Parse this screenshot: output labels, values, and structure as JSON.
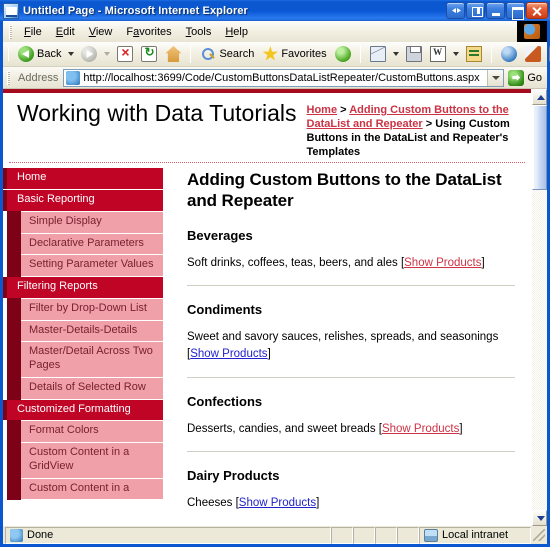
{
  "window": {
    "title": "Untitled Page - Microsoft Internet Explorer",
    "icon": "ie-page-icon",
    "buttons": {
      "restore_tabs": "",
      "panel": "",
      "minimize": "",
      "maximize": "",
      "close": ""
    }
  },
  "menu": {
    "items": [
      {
        "label": "File",
        "accel": "F"
      },
      {
        "label": "Edit",
        "accel": "E"
      },
      {
        "label": "View",
        "accel": "V"
      },
      {
        "label": "Favorites",
        "accel": "a"
      },
      {
        "label": "Tools",
        "accel": "T"
      },
      {
        "label": "Help",
        "accel": "H"
      }
    ],
    "logo_icon": "ie-logo-icon"
  },
  "toolbar": {
    "back_label": "Back",
    "forward_label": "",
    "search_label": "Search",
    "favorites_label": "Favorites",
    "icons": [
      "back-icon",
      "forward-icon",
      "stop-icon",
      "refresh-icon",
      "home-icon",
      "search-icon",
      "favorites-icon",
      "media-icon",
      "mail-icon",
      "print-icon",
      "edit-word-icon",
      "edit-page-icon",
      "msn-icon",
      "messenger-icon",
      "research-icon",
      "grid-icon"
    ]
  },
  "address": {
    "label": "Address",
    "value": "http://localhost:3699/Code/CustomButtonsDataListRepeater/CustomButtons.aspx",
    "go_label": "Go",
    "favicon": "ie-favicon"
  },
  "page": {
    "site_title": "Working with Data Tutorials",
    "breadcrumb": {
      "home": "Home",
      "sep1": " > ",
      "parent": "Adding Custom Buttons to the DataList and Repeater",
      "sep2": " > ",
      "current": "Using Custom Buttons in the DataList and Repeater's Templates"
    },
    "heading": "Adding Custom Buttons to the DataList and Repeater",
    "sidebar": [
      {
        "label": "Home",
        "level": "top"
      },
      {
        "label": "Basic Reporting",
        "level": "top"
      },
      {
        "label": "Simple Display",
        "level": "sub"
      },
      {
        "label": "Declarative Parameters",
        "level": "sub"
      },
      {
        "label": "Setting Parameter Values",
        "level": "sub"
      },
      {
        "label": "Filtering Reports",
        "level": "top"
      },
      {
        "label": "Filter by Drop-Down List",
        "level": "sub"
      },
      {
        "label": "Master-Details-Details",
        "level": "sub"
      },
      {
        "label": "Master/Detail Across Two Pages",
        "level": "sub"
      },
      {
        "label": "Details of Selected Row",
        "level": "sub"
      },
      {
        "label": "Customized Formatting",
        "level": "top"
      },
      {
        "label": "Format Colors",
        "level": "sub"
      },
      {
        "label": "Custom Content in a GridView",
        "level": "sub"
      },
      {
        "label": "Custom Content in a",
        "level": "sub"
      }
    ],
    "categories": [
      {
        "name": "Beverages",
        "description": "Soft drinks, coffees, teas, beers, and ales",
        "link_label": "Show Products",
        "link_state": "red"
      },
      {
        "name": "Condiments",
        "description": "Sweet and savory sauces, relishes, spreads, and seasonings",
        "link_label": "Show Products",
        "link_state": "blue"
      },
      {
        "name": "Confections",
        "description": "Desserts, candies, and sweet breads",
        "link_label": "Show Products",
        "link_state": "red"
      },
      {
        "name": "Dairy Products",
        "description": "Cheeses",
        "link_label": "Show Products",
        "link_state": "blue"
      }
    ],
    "colors": {
      "accent_red": "#c00426",
      "dark_red": "#7d0217",
      "sub_pink": "#f0a0a8",
      "link_red": "#cc3344",
      "link_blue": "#2222cc"
    }
  },
  "status": {
    "text": "Done",
    "zone": "Local intranet",
    "zone_icon": "intranet-icon",
    "doc_icon": "document-icon"
  }
}
